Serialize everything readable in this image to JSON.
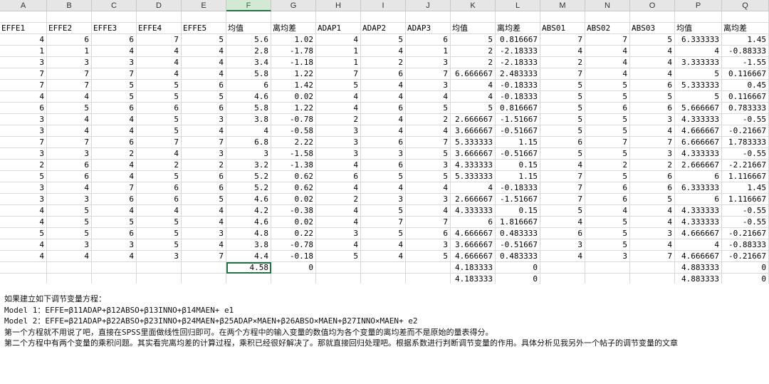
{
  "columns": [
    "A",
    "B",
    "C",
    "D",
    "E",
    "F",
    "G",
    "H",
    "I",
    "J",
    "K",
    "L",
    "M",
    "N",
    "O",
    "P",
    "Q"
  ],
  "selected_column": "F",
  "header_row": [
    "EFFE1",
    "EFFE2",
    "EFFE3",
    "EFFE4",
    "EFFE5",
    "均值",
    "离均差",
    "ADAP1",
    "ADAP2",
    "ADAP3",
    "均值",
    "离均差",
    "ABS01",
    "ABS02",
    "ABS03",
    "均值",
    "离均差"
  ],
  "rows": [
    [
      "4",
      "6",
      "6",
      "7",
      "5",
      "5.6",
      "1.02",
      "4",
      "5",
      "6",
      "5",
      "0.816667",
      "7",
      "7",
      "5",
      "6.333333",
      "1.45"
    ],
    [
      "1",
      "1",
      "4",
      "4",
      "4",
      "2.8",
      "-1.78",
      "1",
      "4",
      "1",
      "2",
      "-2.18333",
      "4",
      "4",
      "4",
      "4",
      "-0.88333"
    ],
    [
      "3",
      "3",
      "3",
      "4",
      "4",
      "3.4",
      "-1.18",
      "1",
      "2",
      "3",
      "2",
      "-2.18333",
      "2",
      "4",
      "4",
      "3.333333",
      "-1.55"
    ],
    [
      "7",
      "7",
      "7",
      "4",
      "4",
      "5.8",
      "1.22",
      "7",
      "6",
      "7",
      "6.666667",
      "2.483333",
      "7",
      "4",
      "4",
      "5",
      "0.116667"
    ],
    [
      "7",
      "7",
      "5",
      "5",
      "6",
      "6",
      "1.42",
      "5",
      "4",
      "3",
      "4",
      "-0.18333",
      "5",
      "5",
      "6",
      "5.333333",
      "0.45"
    ],
    [
      "4",
      "4",
      "5",
      "5",
      "5",
      "4.6",
      "0.02",
      "4",
      "4",
      "4",
      "4",
      "-0.18333",
      "5",
      "5",
      "5",
      "5",
      "0.116667"
    ],
    [
      "6",
      "5",
      "6",
      "6",
      "6",
      "5.8",
      "1.22",
      "4",
      "6",
      "5",
      "5",
      "0.816667",
      "5",
      "6",
      "6",
      "5.666667",
      "0.783333"
    ],
    [
      "3",
      "4",
      "4",
      "5",
      "3",
      "3.8",
      "-0.78",
      "2",
      "4",
      "2",
      "2.666667",
      "-1.51667",
      "5",
      "5",
      "3",
      "4.333333",
      "-0.55"
    ],
    [
      "3",
      "4",
      "4",
      "5",
      "4",
      "4",
      "-0.58",
      "3",
      "4",
      "4",
      "3.666667",
      "-0.51667",
      "5",
      "5",
      "4",
      "4.666667",
      "-0.21667"
    ],
    [
      "7",
      "7",
      "6",
      "7",
      "7",
      "6.8",
      "2.22",
      "3",
      "6",
      "7",
      "5.333333",
      "1.15",
      "6",
      "7",
      "7",
      "6.666667",
      "1.783333"
    ],
    [
      "3",
      "3",
      "2",
      "4",
      "3",
      "3",
      "-1.58",
      "3",
      "3",
      "5",
      "3.666667",
      "-0.51667",
      "5",
      "5",
      "3",
      "4.333333",
      "-0.55"
    ],
    [
      "2",
      "6",
      "4",
      "2",
      "2",
      "3.2",
      "-1.38",
      "4",
      "6",
      "3",
      "4.333333",
      "0.15",
      "4",
      "2",
      "2",
      "2.666667",
      "-2.21667"
    ],
    [
      "5",
      "6",
      "4",
      "5",
      "6",
      "5.2",
      "0.62",
      "6",
      "5",
      "5",
      "5.333333",
      "1.15",
      "7",
      "5",
      "6",
      "6",
      "1.116667"
    ],
    [
      "3",
      "4",
      "7",
      "6",
      "6",
      "5.2",
      "0.62",
      "4",
      "4",
      "4",
      "4",
      "-0.18333",
      "7",
      "6",
      "6",
      "6.333333",
      "1.45"
    ],
    [
      "3",
      "3",
      "6",
      "6",
      "5",
      "4.6",
      "0.02",
      "2",
      "3",
      "3",
      "2.666667",
      "-1.51667",
      "7",
      "6",
      "5",
      "6",
      "1.116667"
    ],
    [
      "4",
      "5",
      "4",
      "4",
      "4",
      "4.2",
      "-0.38",
      "4",
      "5",
      "4",
      "4.333333",
      "0.15",
      "5",
      "4",
      "4",
      "4.333333",
      "-0.55"
    ],
    [
      "4",
      "5",
      "5",
      "5",
      "4",
      "4.6",
      "0.02",
      "4",
      "7",
      "7",
      "6",
      "1.816667",
      "4",
      "5",
      "4",
      "4.333333",
      "-0.55"
    ],
    [
      "5",
      "5",
      "6",
      "5",
      "3",
      "4.8",
      "0.22",
      "3",
      "5",
      "6",
      "4.666667",
      "0.483333",
      "6",
      "5",
      "3",
      "4.666667",
      "-0.21667"
    ],
    [
      "4",
      "3",
      "3",
      "5",
      "4",
      "3.8",
      "-0.78",
      "4",
      "4",
      "3",
      "3.666667",
      "-0.51667",
      "3",
      "5",
      "4",
      "4",
      "-0.88333"
    ],
    [
      "4",
      "4",
      "4",
      "3",
      "7",
      "4.4",
      "-0.18",
      "5",
      "4",
      "5",
      "4.666667",
      "0.483333",
      "4",
      "3",
      "7",
      "4.666667",
      "-0.21667"
    ],
    [
      "",
      "",
      "",
      "",
      "",
      "4.58",
      "0",
      "",
      "",
      "",
      "4.183333",
      "0",
      "",
      "",
      "",
      "4.883333",
      "0"
    ],
    [
      "",
      "",
      "",
      "",
      "",
      "",
      "",
      "",
      "",
      "",
      "4.183333",
      "0",
      "",
      "",
      "",
      "4.883333",
      "0"
    ]
  ],
  "notes": [
    "如果建立如下调节变量方程：",
    "Model 1：EFFE=β11ADAP+β12ABSO+β13INNO+β14MAEN+ e1",
    "Model 2：EFFE=β21ADAP+β22ABSO+β23INNO+β24MAEN+β25ADAP×MAEN+β26ABSO×MAEN+β27INNO×MAEN+ e2",
    "第一个方程就不用说了吧，直接在SPSS里面做线性回归即可。在两个方程中的输入变量的数值均为各个变量的离均差而不是原始的量表得分。",
    "第二个方程中有两个变量的乘积问题。其实看完离均差的计算过程，乘积已经很好解决了。那就直接回归处理吧。根据系数进行判断调节变量的作用。具体分析见我另外一个帖子的调节变量的文章"
  ]
}
